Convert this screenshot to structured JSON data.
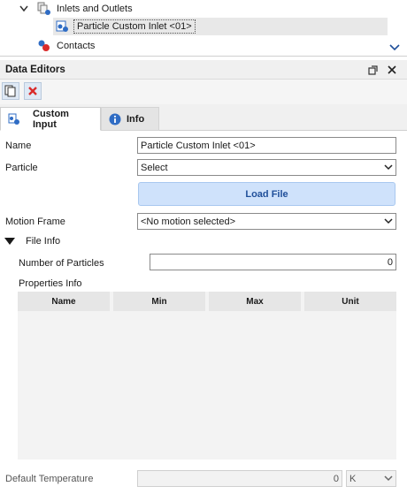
{
  "tree": {
    "items": [
      {
        "label": "Inlets and Outlets",
        "icon": "inlet-outlet-icon"
      },
      {
        "label": "Particle Custom Inlet <01>",
        "icon": "particle-inlet-icon"
      },
      {
        "label": "Contacts",
        "icon": "contacts-icon"
      }
    ]
  },
  "panel": {
    "title": "Data Editors"
  },
  "tabs": [
    {
      "label": "Custom Input",
      "icon": "custom-input-icon"
    },
    {
      "label": "Info",
      "icon": "info-icon"
    }
  ],
  "form": {
    "name_label": "Name",
    "name_value": "Particle Custom Inlet <01>",
    "particle_label": "Particle",
    "particle_value": "Select",
    "load_file_label": "Load File",
    "motion_label": "Motion Frame",
    "motion_value": "<No motion selected>",
    "file_info_label": "File Info",
    "num_particles_label": "Number of Particles",
    "num_particles_value": "0",
    "properties_label": "Properties Info",
    "table_headers": [
      "Name",
      "Min",
      "Max",
      "Unit"
    ],
    "default_temp_label": "Default Temperature",
    "default_temp_value": "0",
    "default_temp_unit": "K"
  },
  "colors": {
    "accent": "#1f4f9a",
    "button_bg": "#cfe2fb",
    "close_red": "#d92b2b"
  }
}
